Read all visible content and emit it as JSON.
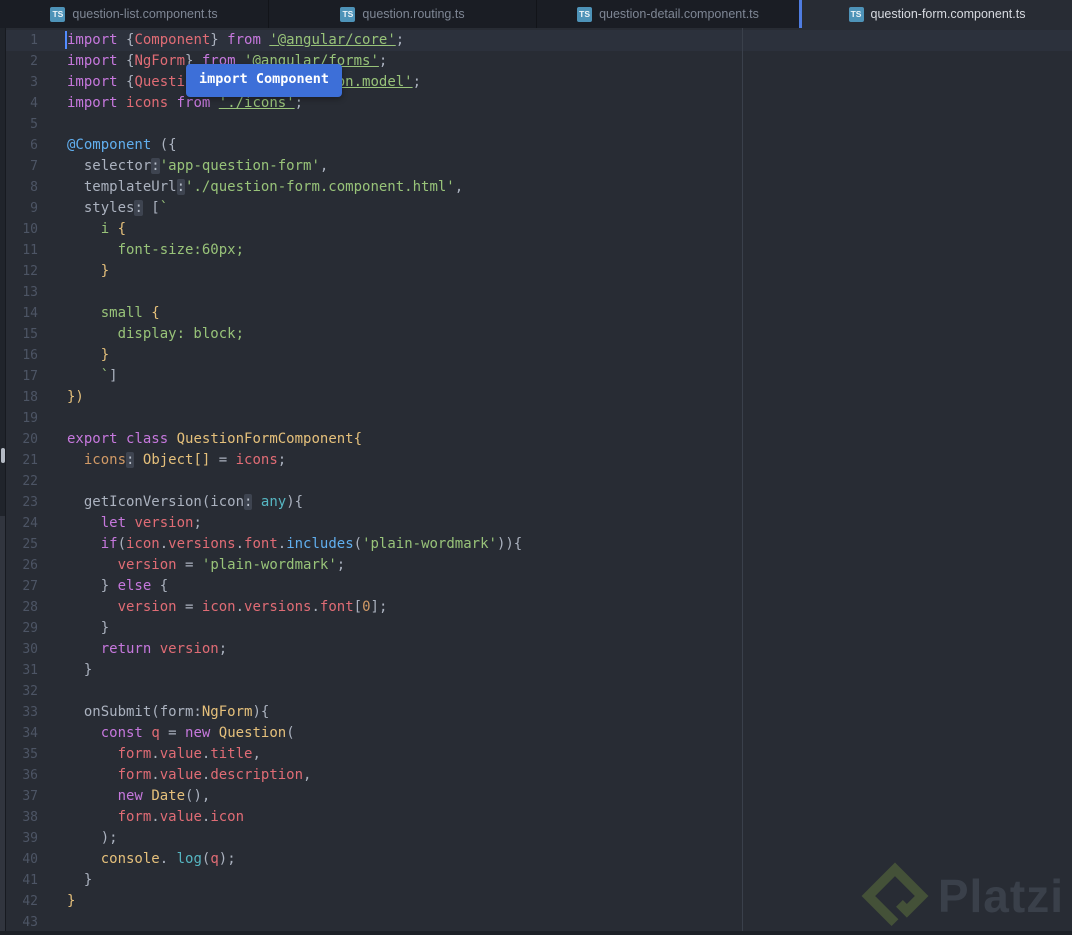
{
  "tab_bar": {
    "tabs": [
      {
        "label": "question-list.component.ts",
        "icon": "TS",
        "active": false
      },
      {
        "label": "question.routing.ts",
        "icon": "TS",
        "active": false
      },
      {
        "label": "question-detail.component.ts",
        "icon": "TS",
        "active": false
      },
      {
        "label": "question-form.component.ts",
        "icon": "TS",
        "active": true
      }
    ]
  },
  "tooltip": {
    "text": "import Component"
  },
  "watermark": {
    "brand": "Platzi"
  },
  "colors": {
    "editor_bg": "#282c34",
    "tab_bar_bg": "#1a1d24",
    "active_tab_accent": "#4f7ce0",
    "tooltip_bg": "#3d6fd8",
    "keyword": "#c678dd",
    "variable": "#e06c75",
    "string": "#98c379",
    "function": "#61afef",
    "type": "#e5c07b",
    "number": "#d19a66",
    "cyan": "#56b6c2",
    "foreground": "#abb2bf",
    "cursor": "#528bff",
    "ts_icon_bg": "#4e93b8"
  },
  "editor": {
    "active_line": 1,
    "line_count": 43,
    "lines": [
      {
        "n": 1,
        "segs": [
          [
            "import",
            "kw"
          ],
          [
            " {",
            "fg"
          ],
          [
            "Component",
            "vr"
          ],
          [
            "} ",
            "fg"
          ],
          [
            "from",
            "kw"
          ],
          [
            " ",
            "fg"
          ],
          [
            "'@angular/core'",
            "su"
          ],
          [
            ";",
            "fg"
          ]
        ]
      },
      {
        "n": 2,
        "segs": [
          [
            "import",
            "kw"
          ],
          [
            " {",
            "fg"
          ],
          [
            "NgForm",
            "vr"
          ],
          [
            "} ",
            "fg"
          ],
          [
            "from",
            "kw"
          ],
          [
            " ",
            "fg"
          ],
          [
            "'@angular/forms'",
            "su"
          ],
          [
            ";",
            "fg"
          ]
        ]
      },
      {
        "n": 3,
        "segs": [
          [
            "import",
            "kw"
          ],
          [
            " {",
            "fg"
          ],
          [
            "Question",
            "vr"
          ],
          [
            "} ",
            "fg"
          ],
          [
            "from",
            "kw"
          ],
          [
            " ",
            "fg"
          ],
          [
            "'./question.model'",
            "su"
          ],
          [
            ";",
            "fg"
          ]
        ]
      },
      {
        "n": 4,
        "segs": [
          [
            "import",
            "kw"
          ],
          [
            " ",
            "fg"
          ],
          [
            "icons",
            "vr"
          ],
          [
            " ",
            "fg"
          ],
          [
            "from",
            "kw"
          ],
          [
            " ",
            "fg"
          ],
          [
            "'./icons'",
            "su"
          ],
          [
            ";",
            "fg"
          ]
        ]
      },
      {
        "n": 5,
        "segs": []
      },
      {
        "n": 6,
        "segs": [
          [
            "@Component",
            "fn"
          ],
          [
            " ({",
            "fg"
          ]
        ]
      },
      {
        "n": 7,
        "segs": [
          [
            "  selector",
            "fg"
          ],
          [
            ":",
            "cb"
          ],
          [
            "'app-question-form'",
            "st"
          ],
          [
            ",",
            "fg"
          ]
        ]
      },
      {
        "n": 8,
        "segs": [
          [
            "  templateUrl",
            "fg"
          ],
          [
            ":",
            "cb"
          ],
          [
            "'./question-form.component.html'",
            "st"
          ],
          [
            ",",
            "fg"
          ]
        ]
      },
      {
        "n": 9,
        "segs": [
          [
            "  styles",
            "fg"
          ],
          [
            ":",
            "cb"
          ],
          [
            " [",
            "fg"
          ],
          [
            "`",
            "st"
          ]
        ]
      },
      {
        "n": 10,
        "segs": [
          [
            "    ",
            "fg"
          ],
          [
            "i ",
            "st"
          ],
          [
            "{",
            "ty"
          ]
        ]
      },
      {
        "n": 11,
        "segs": [
          [
            "      font-size:60px;",
            "st"
          ]
        ]
      },
      {
        "n": 12,
        "segs": [
          [
            "    ",
            "fg"
          ],
          [
            "}",
            "ty"
          ]
        ]
      },
      {
        "n": 13,
        "segs": []
      },
      {
        "n": 14,
        "segs": [
          [
            "    ",
            "fg"
          ],
          [
            "small ",
            "st"
          ],
          [
            "{",
            "ty"
          ]
        ]
      },
      {
        "n": 15,
        "segs": [
          [
            "      display: block;",
            "st"
          ]
        ]
      },
      {
        "n": 16,
        "segs": [
          [
            "    ",
            "fg"
          ],
          [
            "}",
            "ty"
          ]
        ]
      },
      {
        "n": 17,
        "segs": [
          [
            "    ",
            "fg"
          ],
          [
            "`",
            "st"
          ],
          [
            "]",
            "fg"
          ]
        ]
      },
      {
        "n": 18,
        "segs": [
          [
            "})",
            "ty"
          ]
        ]
      },
      {
        "n": 19,
        "segs": []
      },
      {
        "n": 20,
        "segs": [
          [
            "export",
            "kw"
          ],
          [
            " ",
            "fg"
          ],
          [
            "class",
            "kw"
          ],
          [
            " ",
            "fg"
          ],
          [
            "QuestionFormComponent",
            "ty"
          ],
          [
            "{",
            "ty"
          ]
        ]
      },
      {
        "n": 21,
        "segs": [
          [
            "  ",
            "fg"
          ],
          [
            "icons",
            "or"
          ],
          [
            ":",
            "cb"
          ],
          [
            " ",
            "fg"
          ],
          [
            "Object[]",
            "ty"
          ],
          [
            " = ",
            "fg"
          ],
          [
            "icons",
            "vr"
          ],
          [
            ";",
            "fg"
          ]
        ]
      },
      {
        "n": 22,
        "segs": []
      },
      {
        "n": 23,
        "segs": [
          [
            "  getIconVersion(icon",
            "fg"
          ],
          [
            ":",
            "cb"
          ],
          [
            " ",
            "fg"
          ],
          [
            "any",
            "cy"
          ],
          [
            "){",
            "fg"
          ]
        ]
      },
      {
        "n": 24,
        "segs": [
          [
            "    ",
            "fg"
          ],
          [
            "let",
            "kw"
          ],
          [
            " ",
            "fg"
          ],
          [
            "version",
            "vr"
          ],
          [
            ";",
            "fg"
          ]
        ]
      },
      {
        "n": 25,
        "segs": [
          [
            "    ",
            "fg"
          ],
          [
            "if",
            "kw"
          ],
          [
            "(",
            "fg"
          ],
          [
            "icon",
            "vr"
          ],
          [
            ".",
            "fg"
          ],
          [
            "versions",
            "vr"
          ],
          [
            ".",
            "fg"
          ],
          [
            "font",
            "vr"
          ],
          [
            ".",
            "fg"
          ],
          [
            "includes",
            "fn"
          ],
          [
            "(",
            "fg"
          ],
          [
            "'plain-wordmark'",
            "st"
          ],
          [
            ")){",
            "fg"
          ]
        ]
      },
      {
        "n": 26,
        "segs": [
          [
            "      ",
            "fg"
          ],
          [
            "version",
            "vr"
          ],
          [
            " = ",
            "fg"
          ],
          [
            "'plain-wordmark'",
            "st"
          ],
          [
            ";",
            "fg"
          ]
        ]
      },
      {
        "n": 27,
        "segs": [
          [
            "    } ",
            "fg"
          ],
          [
            "else",
            "kw"
          ],
          [
            " {",
            "fg"
          ]
        ]
      },
      {
        "n": 28,
        "segs": [
          [
            "      ",
            "fg"
          ],
          [
            "version",
            "vr"
          ],
          [
            " = ",
            "fg"
          ],
          [
            "icon",
            "vr"
          ],
          [
            ".",
            "fg"
          ],
          [
            "versions",
            "vr"
          ],
          [
            ".",
            "fg"
          ],
          [
            "font",
            "vr"
          ],
          [
            "[",
            "fg"
          ],
          [
            "0",
            "or"
          ],
          [
            "];",
            "fg"
          ]
        ]
      },
      {
        "n": 29,
        "segs": [
          [
            "    }",
            "fg"
          ]
        ]
      },
      {
        "n": 30,
        "segs": [
          [
            "    ",
            "fg"
          ],
          [
            "return",
            "kw"
          ],
          [
            " ",
            "fg"
          ],
          [
            "version",
            "vr"
          ],
          [
            ";",
            "fg"
          ]
        ]
      },
      {
        "n": 31,
        "segs": [
          [
            "  }",
            "fg"
          ]
        ]
      },
      {
        "n": 32,
        "segs": []
      },
      {
        "n": 33,
        "segs": [
          [
            "  onSubmit(form:",
            "fg"
          ],
          [
            "NgForm",
            "ty"
          ],
          [
            "){",
            "fg"
          ]
        ]
      },
      {
        "n": 34,
        "segs": [
          [
            "    ",
            "fg"
          ],
          [
            "const",
            "kw"
          ],
          [
            " ",
            "fg"
          ],
          [
            "q",
            "vr"
          ],
          [
            " = ",
            "fg"
          ],
          [
            "new",
            "kw"
          ],
          [
            " ",
            "fg"
          ],
          [
            "Question",
            "ty"
          ],
          [
            "(",
            "fg"
          ]
        ]
      },
      {
        "n": 35,
        "segs": [
          [
            "      ",
            "fg"
          ],
          [
            "form",
            "vr"
          ],
          [
            ".",
            "fg"
          ],
          [
            "value",
            "vr"
          ],
          [
            ".",
            "fg"
          ],
          [
            "title",
            "vr"
          ],
          [
            ",",
            "fg"
          ]
        ]
      },
      {
        "n": 36,
        "segs": [
          [
            "      ",
            "fg"
          ],
          [
            "form",
            "vr"
          ],
          [
            ".",
            "fg"
          ],
          [
            "value",
            "vr"
          ],
          [
            ".",
            "fg"
          ],
          [
            "description",
            "vr"
          ],
          [
            ",",
            "fg"
          ]
        ]
      },
      {
        "n": 37,
        "segs": [
          [
            "      ",
            "fg"
          ],
          [
            "new",
            "kw"
          ],
          [
            " ",
            "fg"
          ],
          [
            "Date",
            "ty"
          ],
          [
            "(),",
            "fg"
          ]
        ]
      },
      {
        "n": 38,
        "segs": [
          [
            "      ",
            "fg"
          ],
          [
            "form",
            "vr"
          ],
          [
            ".",
            "fg"
          ],
          [
            "value",
            "vr"
          ],
          [
            ".",
            "fg"
          ],
          [
            "icon",
            "vr"
          ]
        ]
      },
      {
        "n": 39,
        "segs": [
          [
            "    );",
            "fg"
          ]
        ]
      },
      {
        "n": 40,
        "segs": [
          [
            "    ",
            "fg"
          ],
          [
            "console",
            "ty"
          ],
          [
            ". ",
            "fg"
          ],
          [
            "log",
            "cy"
          ],
          [
            "(",
            "fg"
          ],
          [
            "q",
            "vr"
          ],
          [
            ");",
            "fg"
          ]
        ]
      },
      {
        "n": 41,
        "segs": [
          [
            "  }",
            "fg"
          ]
        ]
      },
      {
        "n": 42,
        "segs": [
          [
            "}",
            "ty"
          ]
        ]
      },
      {
        "n": 43,
        "segs": []
      }
    ]
  }
}
